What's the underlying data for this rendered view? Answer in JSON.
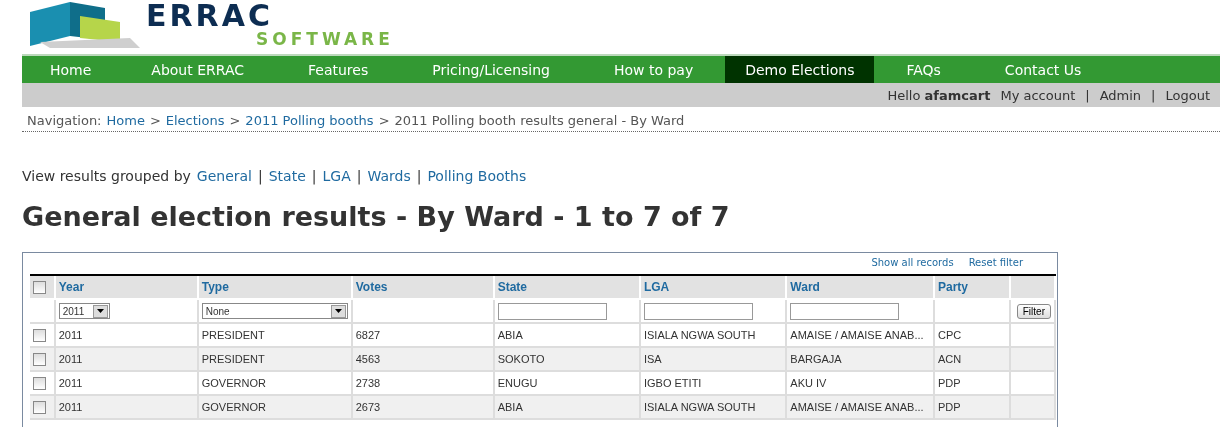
{
  "logo": {
    "name": "ERRAC",
    "tagline": "SOFTWARE"
  },
  "nav": [
    {
      "label": "Home",
      "selected": false
    },
    {
      "label": "About ERRAC",
      "selected": false
    },
    {
      "label": "Features",
      "selected": false
    },
    {
      "label": "Pricing/Licensing",
      "selected": false
    },
    {
      "label": "How to pay",
      "selected": false
    },
    {
      "label": "Demo Elections",
      "selected": true
    },
    {
      "label": "FAQs",
      "selected": false
    },
    {
      "label": "Contact Us",
      "selected": false
    }
  ],
  "user_bar": {
    "greeting": "Hello",
    "username": "afamcart",
    "links": [
      "My account",
      "Admin",
      "Logout"
    ],
    "separator": "|"
  },
  "breadcrumb": {
    "label": "Navigation:",
    "links": [
      "Home",
      "Elections",
      "2011 Polling booths"
    ],
    "current": "2011 Polling booth results general - By Ward",
    "separator": ">"
  },
  "group_by": {
    "label": "View results grouped by",
    "links": [
      "General",
      "State",
      "LGA",
      "Wards",
      "Polling Booths"
    ],
    "separator": "|"
  },
  "heading": "General election results - By Ward - 1 to 7 of 7",
  "table": {
    "actions": [
      "Show all records",
      "Reset filter"
    ],
    "select_all": {
      "checked": false
    },
    "columns": [
      "Year",
      "Type",
      "Votes",
      "State",
      "LGA",
      "Ward",
      "Party"
    ],
    "filters": [
      {
        "kind": "select",
        "value": "2011"
      },
      {
        "kind": "select",
        "value": "None"
      },
      {
        "kind": "none"
      },
      {
        "kind": "text"
      },
      {
        "kind": "text"
      },
      {
        "kind": "text"
      },
      {
        "kind": "none"
      }
    ],
    "filter_button": "Filter",
    "rows": [
      {
        "checked": false,
        "cells": [
          "2011",
          "PRESIDENT",
          "6827",
          "ABIA",
          "ISIALA NGWA SOUTH",
          "AMAISE / AMAISE ANAB...",
          "CPC"
        ]
      },
      {
        "checked": false,
        "cells": [
          "2011",
          "PRESIDENT",
          "4563",
          "SOKOTO",
          "ISA",
          "BARGAJA",
          "ACN"
        ]
      },
      {
        "checked": false,
        "cells": [
          "2011",
          "GOVERNOR",
          "2738",
          "ENUGU",
          "IGBO ETITI",
          "AKU IV",
          "PDP"
        ]
      },
      {
        "checked": false,
        "cells": [
          "2011",
          "GOVERNOR",
          "2673",
          "ABIA",
          "ISIALA NGWA SOUTH",
          "AMAISE / AMAISE ANAB...",
          "PDP"
        ]
      }
    ]
  }
}
